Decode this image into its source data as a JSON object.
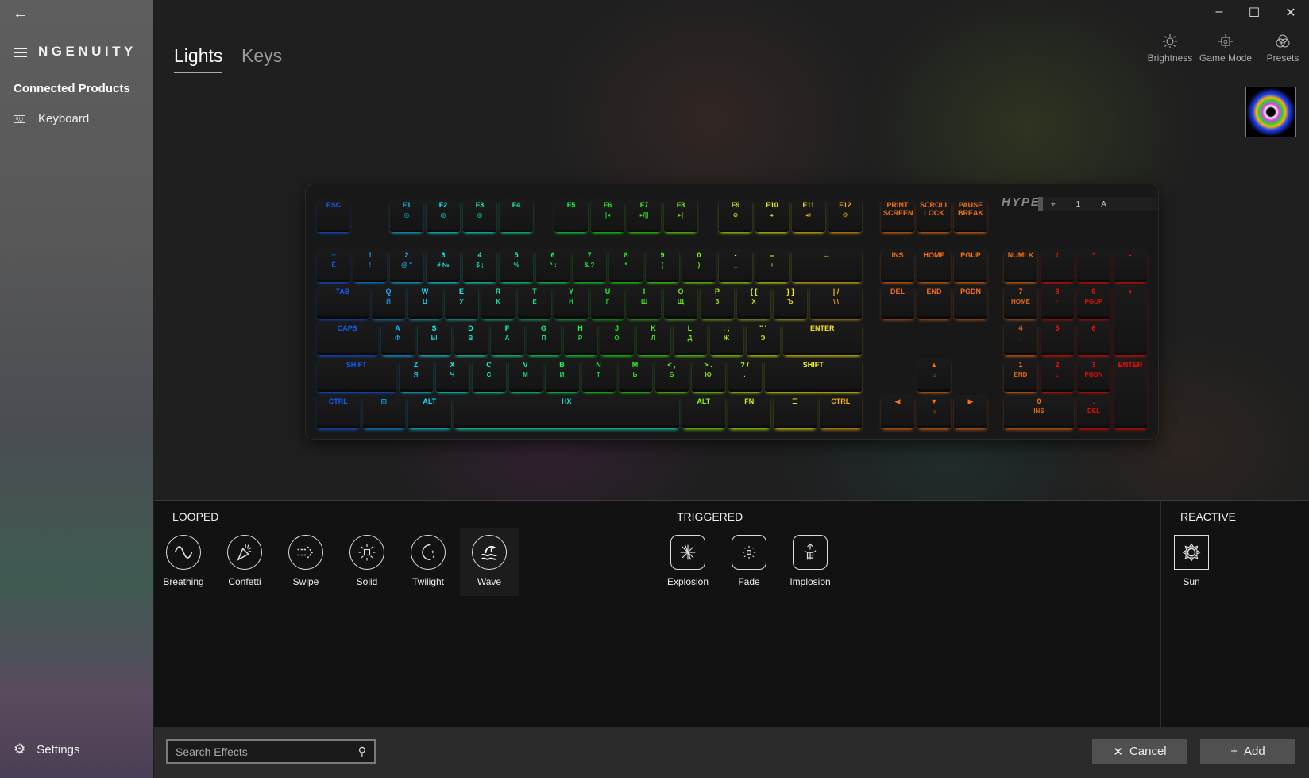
{
  "sidebar": {
    "back_icon": "arrow-left-icon",
    "brand": "NGENUITY",
    "section": "Connected Products",
    "items": [
      {
        "label": "Keyboard",
        "icon": "keyboard-icon"
      }
    ],
    "settings": "Settings"
  },
  "tabs": [
    {
      "label": "Lights",
      "active": true
    },
    {
      "label": "Keys",
      "active": false
    }
  ],
  "window": {
    "minimize": "–",
    "maximize": "☐",
    "close": "✕"
  },
  "toolbar": {
    "brightness": "Brightness",
    "game_mode": "Game Mode",
    "presets": "Presets"
  },
  "keyboard": {
    "brand": "HYPERX",
    "indicators": [
      "1",
      "A"
    ],
    "rows": [
      [
        {
          "l": "ESC"
        },
        {
          "l": "F1",
          "s": "◎"
        },
        {
          "l": "F2",
          "s": "◎"
        },
        {
          "l": "F3",
          "s": "◎"
        },
        {
          "l": "F4"
        },
        {
          "l": "F5"
        },
        {
          "l": "F6",
          "s": "|◂"
        },
        {
          "l": "F7",
          "s": "▸/||"
        },
        {
          "l": "F8",
          "s": "▸|"
        },
        {
          "l": "F9",
          "s": "⊘"
        },
        {
          "l": "F10",
          "s": "◂-"
        },
        {
          "l": "F11",
          "s": "◂+"
        },
        {
          "l": "F12",
          "s": "⚙"
        }
      ],
      [
        {
          "l": "~",
          "s": "Ё"
        },
        {
          "l": "1",
          "s": "!"
        },
        {
          "l": "2",
          "s": "@ \""
        },
        {
          "l": "3",
          "s": "# №"
        },
        {
          "l": "4",
          "s": "$ ;"
        },
        {
          "l": "5",
          "s": "%"
        },
        {
          "l": "6",
          "s": "^ :"
        },
        {
          "l": "7",
          "s": "& ?"
        },
        {
          "l": "8",
          "s": "*"
        },
        {
          "l": "9",
          "s": "("
        },
        {
          "l": "0",
          "s": ")"
        },
        {
          "l": "-",
          "s": "_"
        },
        {
          "l": "=",
          "s": "+"
        },
        {
          "l": "←"
        }
      ],
      [
        {
          "l": "TAB"
        },
        {
          "l": "Q",
          "s": "Й"
        },
        {
          "l": "W",
          "s": "Ц"
        },
        {
          "l": "E",
          "s": "У"
        },
        {
          "l": "R",
          "s": "К"
        },
        {
          "l": "T",
          "s": "Е"
        },
        {
          "l": "Y",
          "s": "Н"
        },
        {
          "l": "U",
          "s": "Г"
        },
        {
          "l": "I",
          "s": "Ш"
        },
        {
          "l": "O",
          "s": "Щ"
        },
        {
          "l": "P",
          "s": "З"
        },
        {
          "l": "{ [",
          "s": "Х"
        },
        {
          "l": "} ]",
          "s": "Ъ"
        },
        {
          "l": "| /",
          "s": "\\ \\"
        }
      ],
      [
        {
          "l": "CAPS"
        },
        {
          "l": "A",
          "s": "Ф"
        },
        {
          "l": "S",
          "s": "Ы"
        },
        {
          "l": "D",
          "s": "В"
        },
        {
          "l": "F",
          "s": "А"
        },
        {
          "l": "G",
          "s": "П"
        },
        {
          "l": "H",
          "s": "Р"
        },
        {
          "l": "J",
          "s": "О"
        },
        {
          "l": "K",
          "s": "Л"
        },
        {
          "l": "L",
          "s": "Д"
        },
        {
          "l": ": ;",
          "s": "Ж"
        },
        {
          "l": "\" '",
          "s": "Э"
        },
        {
          "l": "ENTER"
        }
      ],
      [
        {
          "l": "SHIFT"
        },
        {
          "l": "Z",
          "s": "Я"
        },
        {
          "l": "X",
          "s": "Ч"
        },
        {
          "l": "C",
          "s": "С"
        },
        {
          "l": "V",
          "s": "М"
        },
        {
          "l": "B",
          "s": "И"
        },
        {
          "l": "N",
          "s": "Т"
        },
        {
          "l": "M",
          "s": "Ь"
        },
        {
          "l": "< ,",
          "s": "Б"
        },
        {
          "l": "> .",
          "s": "Ю"
        },
        {
          "l": "? /",
          "s": "."
        },
        {
          "l": "SHIFT"
        }
      ],
      [
        {
          "l": "CTRL"
        },
        {
          "l": "⊞"
        },
        {
          "l": "ALT"
        },
        {
          "l": "HX"
        },
        {
          "l": "ALT"
        },
        {
          "l": "FN"
        },
        {
          "l": "☰"
        },
        {
          "l": "CTRL"
        }
      ]
    ],
    "nav": [
      {
        "l": "PRINT SCREEN"
      },
      {
        "l": "SCROLL LOCK"
      },
      {
        "l": "PAUSE BREAK"
      },
      {
        "l": "INS"
      },
      {
        "l": "HOME"
      },
      {
        "l": "PGUP"
      },
      {
        "l": "DEL"
      },
      {
        "l": "END"
      },
      {
        "l": "PGDN"
      },
      {
        "l": "▲",
        "s": "☼"
      },
      {
        "l": "◀"
      },
      {
        "l": "▼",
        "s": "☼"
      },
      {
        "l": "▶"
      }
    ],
    "numpad": [
      {
        "l": "NUMLK"
      },
      {
        "l": "/"
      },
      {
        "l": "*"
      },
      {
        "l": "-"
      },
      {
        "l": "7",
        "s": "HOME"
      },
      {
        "l": "8",
        "s": "↑"
      },
      {
        "l": "9",
        "s": "PGUP"
      },
      {
        "l": "+"
      },
      {
        "l": "4",
        "s": "←"
      },
      {
        "l": "5"
      },
      {
        "l": "6",
        "s": "→"
      },
      {
        "l": "1",
        "s": "END"
      },
      {
        "l": "2",
        "s": "↓"
      },
      {
        "l": "3",
        "s": "PGDN"
      },
      {
        "l": "ENTER"
      },
      {
        "l": "0",
        "s": "INS"
      },
      {
        "l": ".",
        "s": "DEL"
      }
    ]
  },
  "effects": {
    "looped": {
      "title": "LOOPED",
      "items": [
        {
          "label": "Breathing",
          "icon": "sine-wave-icon"
        },
        {
          "label": "Confetti",
          "icon": "party-popper-icon"
        },
        {
          "label": "Swipe",
          "icon": "swipe-arrow-icon"
        },
        {
          "label": "Solid",
          "icon": "solid-sun-icon"
        },
        {
          "label": "Twilight",
          "icon": "moon-stars-icon"
        },
        {
          "label": "Wave",
          "icon": "wave-icon",
          "selected": true
        }
      ]
    },
    "triggered": {
      "title": "TRIGGERED",
      "items": [
        {
          "label": "Explosion",
          "icon": "explosion-icon"
        },
        {
          "label": "Fade",
          "icon": "fade-icon"
        },
        {
          "label": "Implosion",
          "icon": "implosion-icon"
        }
      ]
    },
    "reactive": {
      "title": "REACTIVE",
      "items": [
        {
          "label": "Sun",
          "icon": "sun-gear-icon"
        }
      ]
    }
  },
  "bottom": {
    "search_placeholder": "Search Effects",
    "cancel": "Cancel",
    "add": "Add"
  }
}
